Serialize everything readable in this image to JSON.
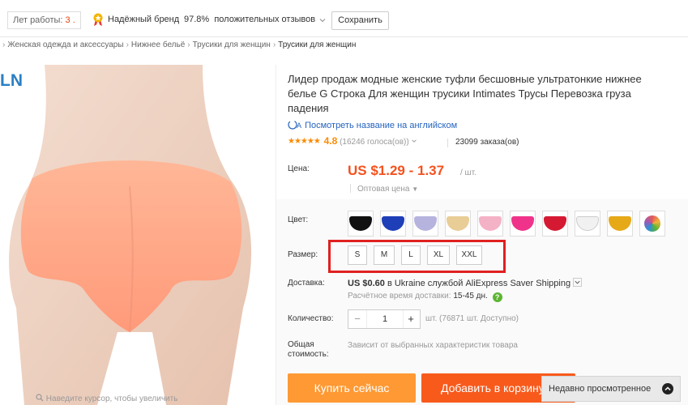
{
  "header": {
    "years_label": "Лет работы:",
    "years_value": "3",
    "brand_label": "Надёжный бренд",
    "positive_pct": "97.8%",
    "positive_label": "положительных отзывов",
    "save_label": "Сохранить"
  },
  "breadcrumb": [
    "Женская одежда и аксессуары",
    "Нижнее бельё",
    "Трусики для женщин",
    "Трусики для женщин"
  ],
  "gallery": {
    "logo_fragment": "LN",
    "zoom_hint": "Наведите курсор, чтобы увеличить"
  },
  "product": {
    "title": "Лидер продаж модные женские туфли бесшовные ультратонкие нижнее белье G Строка Для женщин трусики Intimates Трусы Перевозка груза падения",
    "english_link": "Посмотреть название на английском",
    "rating_score": "4.8",
    "votes": "(16246 голоса(ов))",
    "orders": "23099 заказа(ов)",
    "price_label": "Цена:",
    "price": "US $1.29 - 1.37",
    "price_unit": "/ шт.",
    "wholesale": "Оптовая цена",
    "color_label": "Цвет:",
    "colors": [
      {
        "name": "black",
        "hex": "#111111"
      },
      {
        "name": "blue",
        "hex": "#1f3fb8"
      },
      {
        "name": "lavender",
        "hex": "#b6b4de"
      },
      {
        "name": "beige",
        "hex": "#e9cd96"
      },
      {
        "name": "light-pink",
        "hex": "#f4b2c6"
      },
      {
        "name": "hot-pink",
        "hex": "#f0338a"
      },
      {
        "name": "red",
        "hex": "#d61932"
      },
      {
        "name": "white",
        "hex": "#f1f1f1"
      },
      {
        "name": "yellow",
        "hex": "#e6a918"
      },
      {
        "name": "assorted",
        "hex": "#e25a5a"
      }
    ],
    "size_label": "Размер:",
    "sizes": [
      "S",
      "M",
      "L",
      "XL",
      "XXL"
    ],
    "shipping_label": "Доставка:",
    "shipping_price": "US $0.60",
    "shipping_text": "в Ukraine службой AliExpress Saver Shipping",
    "delivery_label": "Расчётное время доставки:",
    "delivery_time": "15-45 дн.",
    "quantity_label": "Количество:",
    "quantity_value": "1",
    "available": "шт. (76871 шт. Доступно)",
    "total_label_1": "Общая",
    "total_label_2": "стоимость:",
    "total_text": "Зависит от выбранных характеристик товара",
    "buy_now": "Купить сейчас",
    "add_to_cart": "Добавить в корзину",
    "recently_viewed": "Недавно просмотренное"
  },
  "colors": {
    "accent_price": "#f4511e",
    "buy_button": "#ff9933",
    "cart_button": "#f85a1c",
    "highlight_box": "#e02020",
    "link": "#2563bf"
  }
}
